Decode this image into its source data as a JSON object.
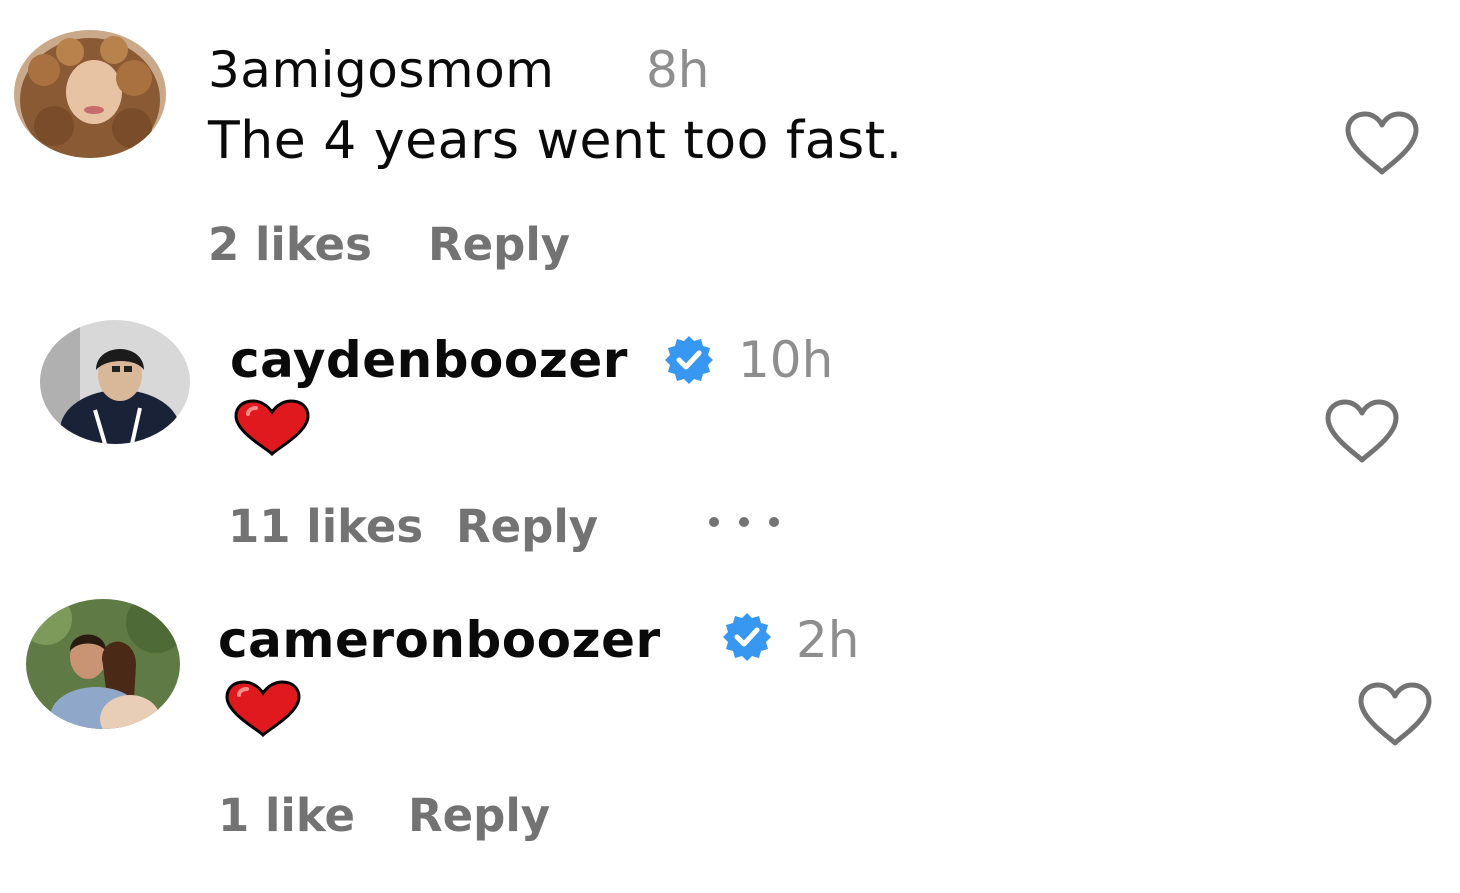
{
  "comments": [
    {
      "username": "3amigosmom",
      "time": "8h",
      "verified": false,
      "text": "The 4 years went too fast.",
      "likes_label": "2 likes",
      "reply_label": "Reply",
      "avatar_icon": "profile-photo-curly-hair",
      "like_icon": "heart-outline-icon"
    },
    {
      "username": "caydenboozer",
      "time": "10h",
      "verified": true,
      "emoji": "red-heart-emoji",
      "likes_label": "11 likes",
      "reply_label": "Reply",
      "more_label": "•••",
      "avatar_icon": "profile-photo-dark-hair",
      "like_icon": "heart-outline-icon"
    },
    {
      "username": "cameronboozer",
      "time": "2h",
      "verified": true,
      "emoji": "red-heart-emoji",
      "likes_label": "1 like",
      "reply_label": "Reply",
      "avatar_icon": "profile-photo-couple",
      "like_icon": "heart-outline-icon"
    }
  ],
  "colors": {
    "verified_blue": "#3897f0",
    "heart_red": "#e0191e",
    "muted_text": "#737373",
    "time_gray": "#8e8e8e"
  }
}
